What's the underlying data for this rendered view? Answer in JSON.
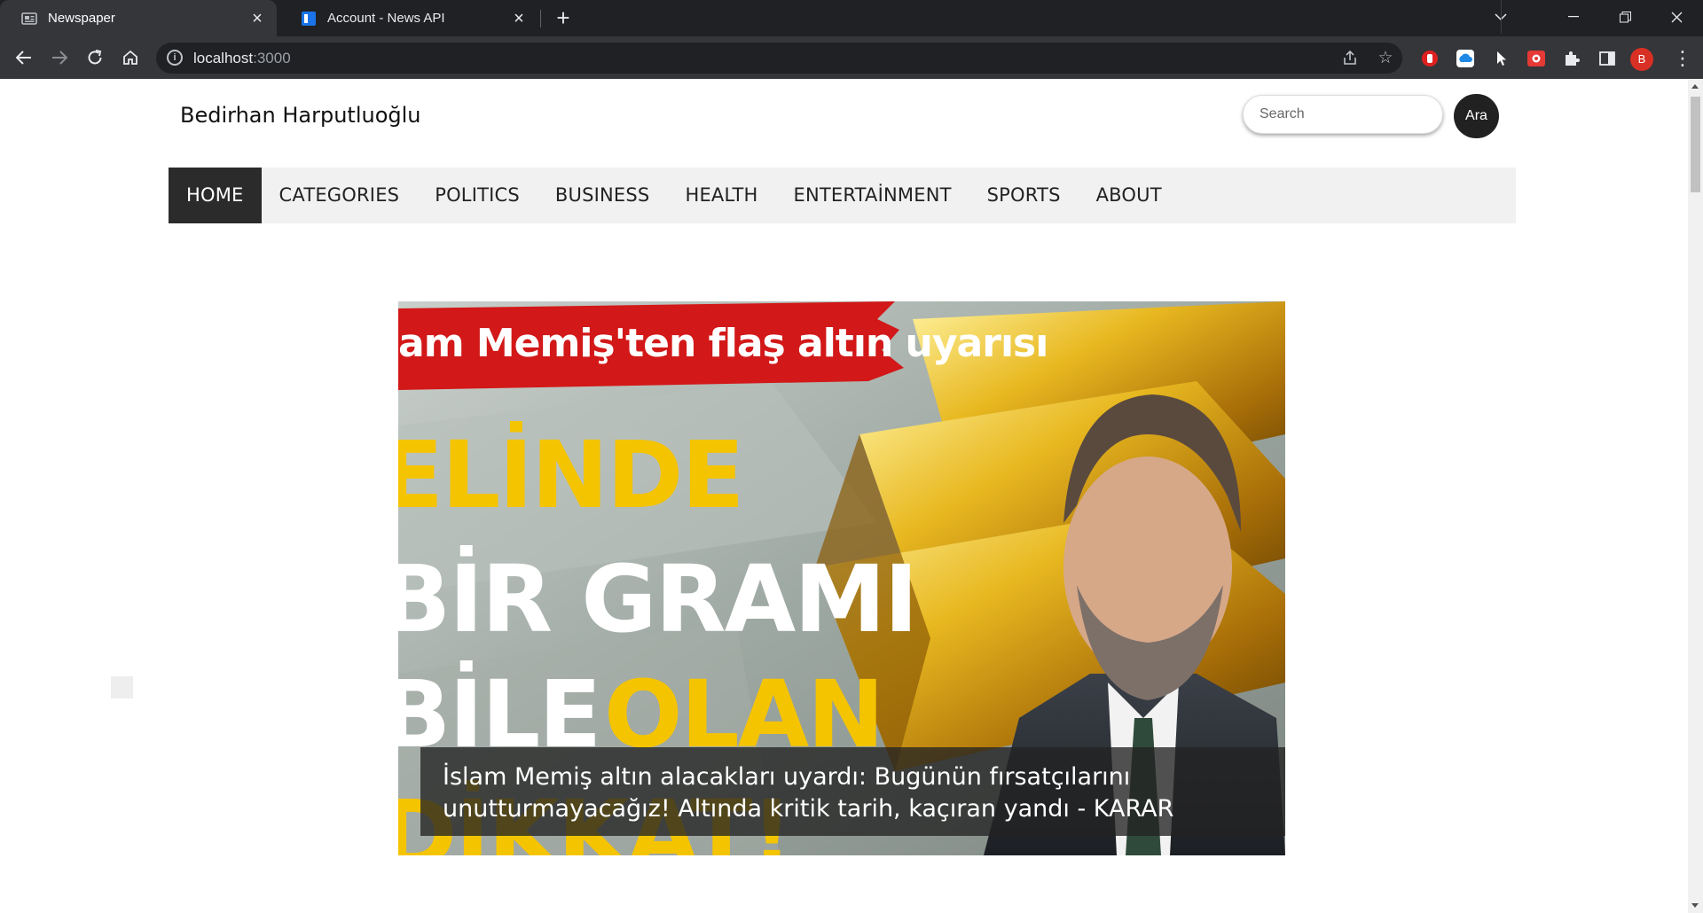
{
  "browser": {
    "tabs": [
      {
        "title": "Newspaper",
        "icon": "newspaper-icon",
        "active": true
      },
      {
        "title": "Account - News API",
        "icon": "newsapi-icon",
        "active": false
      }
    ],
    "address": {
      "host": "localhost",
      "port": ":3000"
    },
    "profile_initial": "B"
  },
  "site": {
    "name": "Bedirhan Harputluoğlu",
    "search": {
      "placeholder": "Search",
      "button": "Ara"
    },
    "nav": [
      "HOME",
      "CATEGORIES",
      "POLITICS",
      "BUSINESS",
      "HEALTH",
      "ENTERTAİNMENT",
      "SPORTS",
      "ABOUT"
    ],
    "active_nav": "HOME"
  },
  "hero": {
    "image_text": {
      "banner": "am Memiş'ten flaş altın uyarısı",
      "line1": "ELİNDE",
      "line2": "BİR GRAMI",
      "line3a": "BİLE",
      "line3b": "OLAN",
      "line4": "DİKKAT!"
    },
    "caption": "İslam Memiş altın alacakları uyardı: Bugünün fırsatçılarını unutturmayacağız! Altında kritik tarih, kaçıran yandı - KARAR"
  },
  "colors": {
    "tabstrip": "#202124",
    "toolbar": "#35363a",
    "nav_bg": "#f1f1f1",
    "nav_active": "#2b2b2b",
    "accent_red": "#d93025",
    "headline_yellow": "#f5c400"
  }
}
